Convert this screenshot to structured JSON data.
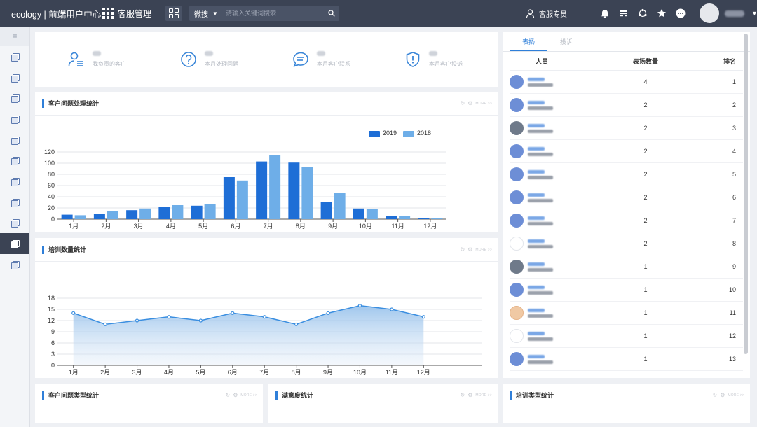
{
  "topbar": {
    "brand": "ecology | 前端用户中心",
    "module": "客服管理",
    "search_scope": "微搜",
    "search_placeholder": "请输入关键词搜索",
    "service_label": "客服专员",
    "icons": [
      "bell-icon",
      "calendar-icon",
      "share-icon",
      "star-icon",
      "more-icon"
    ]
  },
  "sidebar": {
    "items": [
      "doc-icon",
      "doc-icon",
      "doc-icon",
      "doc-icon",
      "doc-icon",
      "doc-icon",
      "doc-icon",
      "doc-icon",
      "doc-icon",
      "doc-icon",
      "doc-icon"
    ],
    "active_index": 9
  },
  "stats": [
    {
      "label": "我负责的客户",
      "icon": "user-list-icon"
    },
    {
      "label": "本月处理问题",
      "icon": "question-icon"
    },
    {
      "label": "本月客户联系",
      "icon": "message-icon"
    },
    {
      "label": "本月客户投诉",
      "icon": "shield-alert-icon"
    }
  ],
  "panels": {
    "issue_stats": "客户问题处理统计",
    "training_stats": "培训数量统计",
    "issue_type_stats": "客户问题类型统计",
    "satisfaction_stats": "满意度统计",
    "training_type_stats": "培训类型统计",
    "more_label": "MORE >>"
  },
  "chart_data": [
    {
      "type": "bar",
      "categories": [
        "1月",
        "2月",
        "3月",
        "4月",
        "5月",
        "6月",
        "7月",
        "8月",
        "9月",
        "10月",
        "11月",
        "12月"
      ],
      "series": [
        {
          "name": "2019",
          "color": "#1e6ed6",
          "values": [
            8,
            10,
            16,
            22,
            24,
            75,
            103,
            101,
            31,
            19,
            5,
            2
          ]
        },
        {
          "name": "2018",
          "color": "#6eaee8",
          "values": [
            7,
            14,
            19,
            25,
            27,
            69,
            114,
            93,
            47,
            18,
            5,
            2
          ]
        }
      ],
      "yticks": [
        0,
        20,
        40,
        60,
        80,
        100,
        120
      ],
      "ylim": [
        0,
        120
      ],
      "grid": true,
      "legend": "top-right"
    },
    {
      "type": "area",
      "categories": [
        "1月",
        "2月",
        "3月",
        "4月",
        "5月",
        "6月",
        "7月",
        "8月",
        "9月",
        "10月",
        "11月",
        "12月"
      ],
      "series": [
        {
          "color": "#3a8ee0",
          "values": [
            14,
            11,
            12,
            13,
            12,
            14,
            13,
            11,
            14,
            16,
            15,
            13
          ]
        }
      ],
      "yticks": [
        0,
        3,
        6,
        9,
        12,
        15,
        18
      ],
      "ylim": [
        0,
        18
      ],
      "grid": true
    }
  ],
  "ranking": {
    "tabs": [
      "表扬",
      "投诉"
    ],
    "active_tab": 0,
    "columns": [
      "人员",
      "表扬数量",
      "排名"
    ],
    "rows": [
      {
        "count": "4",
        "rank": "1",
        "avatar": "blue"
      },
      {
        "count": "2",
        "rank": "2",
        "avatar": "blue"
      },
      {
        "count": "2",
        "rank": "3",
        "avatar": "photo"
      },
      {
        "count": "2",
        "rank": "4",
        "avatar": "blue"
      },
      {
        "count": "2",
        "rank": "5",
        "avatar": "blue"
      },
      {
        "count": "2",
        "rank": "6",
        "avatar": "blue"
      },
      {
        "count": "2",
        "rank": "7",
        "avatar": "blue"
      },
      {
        "count": "2",
        "rank": "8",
        "avatar": "face2"
      },
      {
        "count": "1",
        "rank": "9",
        "avatar": "photo"
      },
      {
        "count": "1",
        "rank": "10",
        "avatar": "blue"
      },
      {
        "count": "1",
        "rank": "11",
        "avatar": "face"
      },
      {
        "count": "1",
        "rank": "12",
        "avatar": "face2"
      },
      {
        "count": "1",
        "rank": "13",
        "avatar": "blue"
      }
    ]
  }
}
